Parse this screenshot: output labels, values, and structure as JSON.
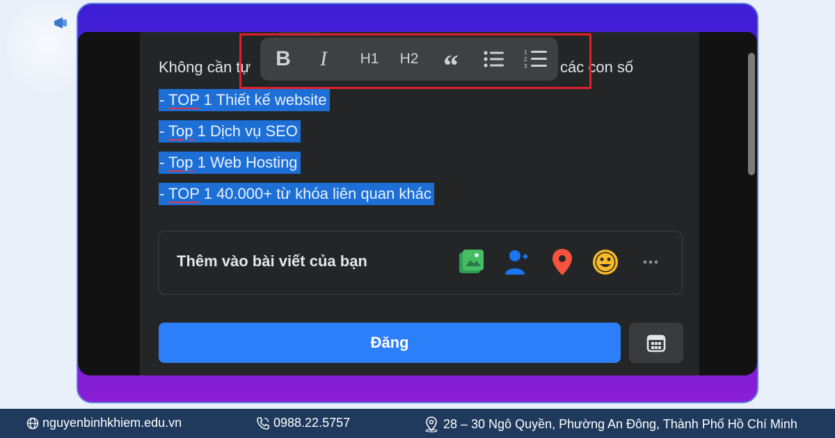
{
  "editor": {
    "intro_left": "Không cần tự",
    "intro_right": "các con số",
    "selected_lines": [
      {
        "prefix": "- ",
        "underlined": "TOP",
        "rest": " 1 Thiết kế website"
      },
      {
        "prefix": "- ",
        "underlined": "Top",
        "rest": " 1 Dịch vụ SEO"
      },
      {
        "prefix": "- ",
        "underlined": "Top",
        "rest": " 1 Web Hosting"
      },
      {
        "prefix": "- ",
        "underlined": "TOP",
        "rest": " 1 40.000+  từ khóa liên quan khác"
      }
    ]
  },
  "format_toolbar": {
    "bold": "B",
    "italic": "I",
    "h1": "H1",
    "h2": "H2",
    "quote": "“",
    "bullet_list_icon": "bullet-list-icon",
    "numbered_list_icon": "numbered-list-icon",
    "highlight_color": "#e0202a"
  },
  "add_to_post": {
    "label": "Thêm vào bài viết của bạn",
    "icons": [
      "photo-video-icon",
      "tag-people-icon",
      "location-pin-icon",
      "feeling-emoji-icon",
      "more-options-icon"
    ]
  },
  "actions": {
    "post_label": "Đăng",
    "schedule_icon": "calendar-icon",
    "accent": "#2d7ff9"
  },
  "footer": {
    "website": "nguyenbinhkhiem.edu.vn",
    "phone": "0988.22.5757",
    "address": "28 – 30 Ngô Quyền, Phường An Đông, Thành Phố Hồ Chí Minh"
  }
}
